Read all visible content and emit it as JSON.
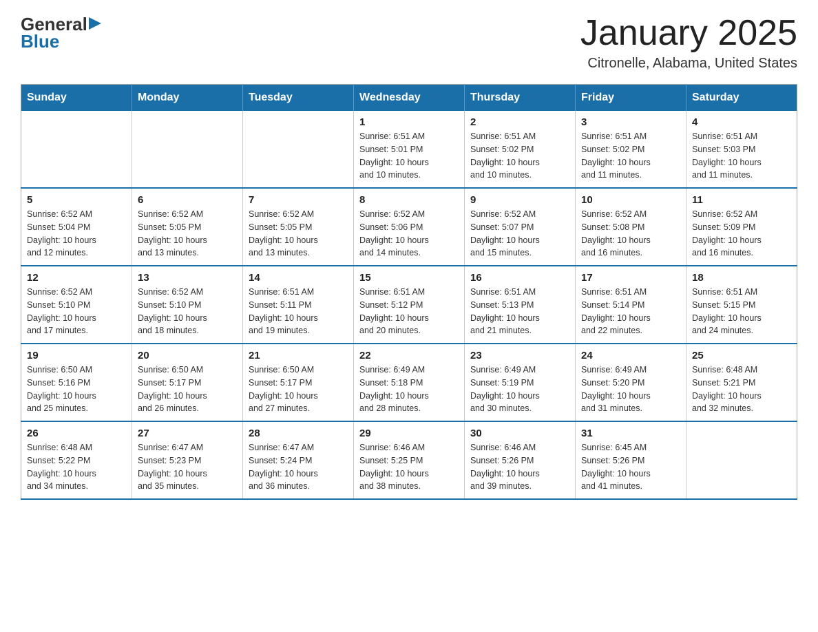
{
  "logo": {
    "general": "General",
    "blue": "Blue",
    "arrow": "▶"
  },
  "header": {
    "title": "January 2025",
    "location": "Citronelle, Alabama, United States"
  },
  "weekdays": [
    "Sunday",
    "Monday",
    "Tuesday",
    "Wednesday",
    "Thursday",
    "Friday",
    "Saturday"
  ],
  "weeks": [
    [
      {
        "day": "",
        "info": ""
      },
      {
        "day": "",
        "info": ""
      },
      {
        "day": "",
        "info": ""
      },
      {
        "day": "1",
        "info": "Sunrise: 6:51 AM\nSunset: 5:01 PM\nDaylight: 10 hours\nand 10 minutes."
      },
      {
        "day": "2",
        "info": "Sunrise: 6:51 AM\nSunset: 5:02 PM\nDaylight: 10 hours\nand 10 minutes."
      },
      {
        "day": "3",
        "info": "Sunrise: 6:51 AM\nSunset: 5:02 PM\nDaylight: 10 hours\nand 11 minutes."
      },
      {
        "day": "4",
        "info": "Sunrise: 6:51 AM\nSunset: 5:03 PM\nDaylight: 10 hours\nand 11 minutes."
      }
    ],
    [
      {
        "day": "5",
        "info": "Sunrise: 6:52 AM\nSunset: 5:04 PM\nDaylight: 10 hours\nand 12 minutes."
      },
      {
        "day": "6",
        "info": "Sunrise: 6:52 AM\nSunset: 5:05 PM\nDaylight: 10 hours\nand 13 minutes."
      },
      {
        "day": "7",
        "info": "Sunrise: 6:52 AM\nSunset: 5:05 PM\nDaylight: 10 hours\nand 13 minutes."
      },
      {
        "day": "8",
        "info": "Sunrise: 6:52 AM\nSunset: 5:06 PM\nDaylight: 10 hours\nand 14 minutes."
      },
      {
        "day": "9",
        "info": "Sunrise: 6:52 AM\nSunset: 5:07 PM\nDaylight: 10 hours\nand 15 minutes."
      },
      {
        "day": "10",
        "info": "Sunrise: 6:52 AM\nSunset: 5:08 PM\nDaylight: 10 hours\nand 16 minutes."
      },
      {
        "day": "11",
        "info": "Sunrise: 6:52 AM\nSunset: 5:09 PM\nDaylight: 10 hours\nand 16 minutes."
      }
    ],
    [
      {
        "day": "12",
        "info": "Sunrise: 6:52 AM\nSunset: 5:10 PM\nDaylight: 10 hours\nand 17 minutes."
      },
      {
        "day": "13",
        "info": "Sunrise: 6:52 AM\nSunset: 5:10 PM\nDaylight: 10 hours\nand 18 minutes."
      },
      {
        "day": "14",
        "info": "Sunrise: 6:51 AM\nSunset: 5:11 PM\nDaylight: 10 hours\nand 19 minutes."
      },
      {
        "day": "15",
        "info": "Sunrise: 6:51 AM\nSunset: 5:12 PM\nDaylight: 10 hours\nand 20 minutes."
      },
      {
        "day": "16",
        "info": "Sunrise: 6:51 AM\nSunset: 5:13 PM\nDaylight: 10 hours\nand 21 minutes."
      },
      {
        "day": "17",
        "info": "Sunrise: 6:51 AM\nSunset: 5:14 PM\nDaylight: 10 hours\nand 22 minutes."
      },
      {
        "day": "18",
        "info": "Sunrise: 6:51 AM\nSunset: 5:15 PM\nDaylight: 10 hours\nand 24 minutes."
      }
    ],
    [
      {
        "day": "19",
        "info": "Sunrise: 6:50 AM\nSunset: 5:16 PM\nDaylight: 10 hours\nand 25 minutes."
      },
      {
        "day": "20",
        "info": "Sunrise: 6:50 AM\nSunset: 5:17 PM\nDaylight: 10 hours\nand 26 minutes."
      },
      {
        "day": "21",
        "info": "Sunrise: 6:50 AM\nSunset: 5:17 PM\nDaylight: 10 hours\nand 27 minutes."
      },
      {
        "day": "22",
        "info": "Sunrise: 6:49 AM\nSunset: 5:18 PM\nDaylight: 10 hours\nand 28 minutes."
      },
      {
        "day": "23",
        "info": "Sunrise: 6:49 AM\nSunset: 5:19 PM\nDaylight: 10 hours\nand 30 minutes."
      },
      {
        "day": "24",
        "info": "Sunrise: 6:49 AM\nSunset: 5:20 PM\nDaylight: 10 hours\nand 31 minutes."
      },
      {
        "day": "25",
        "info": "Sunrise: 6:48 AM\nSunset: 5:21 PM\nDaylight: 10 hours\nand 32 minutes."
      }
    ],
    [
      {
        "day": "26",
        "info": "Sunrise: 6:48 AM\nSunset: 5:22 PM\nDaylight: 10 hours\nand 34 minutes."
      },
      {
        "day": "27",
        "info": "Sunrise: 6:47 AM\nSunset: 5:23 PM\nDaylight: 10 hours\nand 35 minutes."
      },
      {
        "day": "28",
        "info": "Sunrise: 6:47 AM\nSunset: 5:24 PM\nDaylight: 10 hours\nand 36 minutes."
      },
      {
        "day": "29",
        "info": "Sunrise: 6:46 AM\nSunset: 5:25 PM\nDaylight: 10 hours\nand 38 minutes."
      },
      {
        "day": "30",
        "info": "Sunrise: 6:46 AM\nSunset: 5:26 PM\nDaylight: 10 hours\nand 39 minutes."
      },
      {
        "day": "31",
        "info": "Sunrise: 6:45 AM\nSunset: 5:26 PM\nDaylight: 10 hours\nand 41 minutes."
      },
      {
        "day": "",
        "info": ""
      }
    ]
  ]
}
